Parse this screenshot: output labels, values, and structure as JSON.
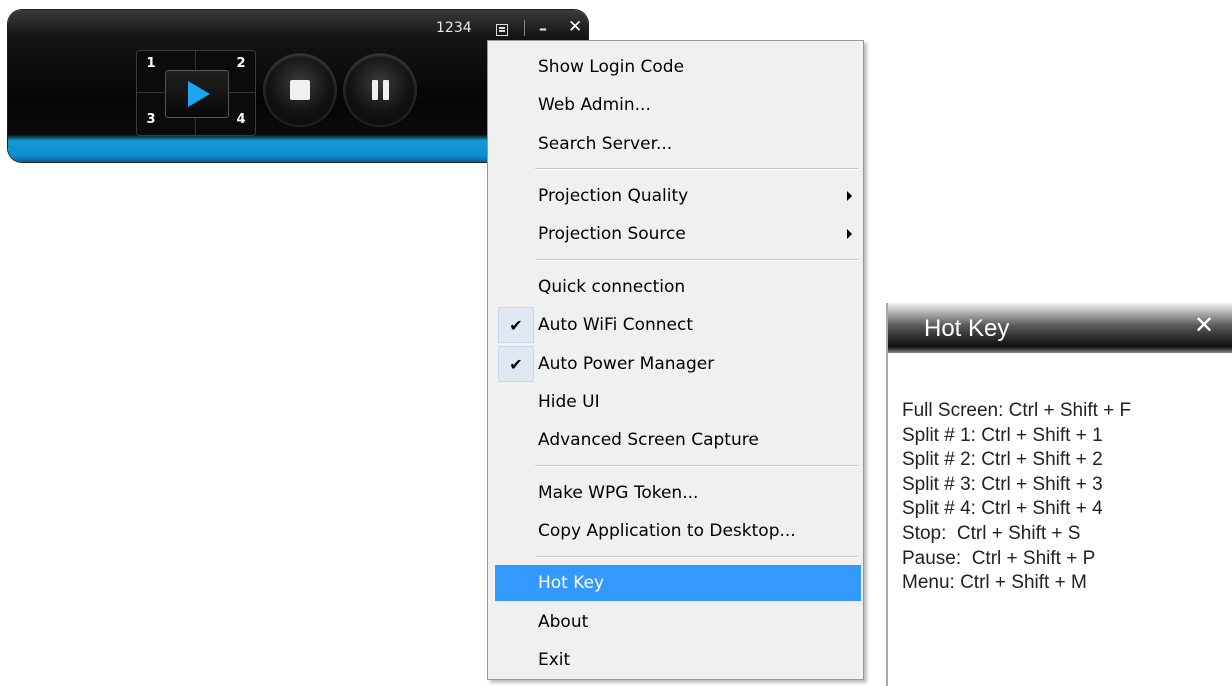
{
  "player": {
    "login_code": "1234",
    "split_labels": [
      "1",
      "2",
      "3",
      "4"
    ],
    "icons": {
      "play": "play-icon",
      "stop": "stop-icon",
      "pause": "pause-icon",
      "layout": "layout-icon",
      "minimize": "minimize-icon",
      "close": "close-icon"
    },
    "colors": {
      "accent": "#19a8ef",
      "bar_bottom": "#0a8fd0"
    }
  },
  "menu": {
    "items": [
      {
        "label": "Show Login Code",
        "checked": false,
        "submenu": false
      },
      {
        "label": "Web Admin...",
        "checked": false,
        "submenu": false
      },
      {
        "label": "Search Server...",
        "checked": false,
        "submenu": false
      },
      {
        "label": "Projection Quality",
        "checked": false,
        "submenu": true
      },
      {
        "label": "Projection Source",
        "checked": false,
        "submenu": true
      },
      {
        "label": "Quick connection",
        "checked": false,
        "submenu": false
      },
      {
        "label": "Auto WiFi Connect",
        "checked": true,
        "submenu": false
      },
      {
        "label": "Auto Power Manager",
        "checked": true,
        "submenu": false
      },
      {
        "label": "Hide UI",
        "checked": false,
        "submenu": false
      },
      {
        "label": "Advanced Screen Capture",
        "checked": false,
        "submenu": false
      },
      {
        "label": "Make WPG Token...",
        "checked": false,
        "submenu": false
      },
      {
        "label": "Copy Application to Desktop...",
        "checked": false,
        "submenu": false
      },
      {
        "label": "Hot Key",
        "checked": false,
        "submenu": false,
        "highlighted": true
      },
      {
        "label": "About",
        "checked": false,
        "submenu": false
      },
      {
        "label": "Exit",
        "checked": false,
        "submenu": false
      }
    ],
    "check_glyph": "✔",
    "highlight_color": "#3399ff"
  },
  "hotkey_window": {
    "title": "Hot Key",
    "close_glyph": "✕",
    "lines": [
      "Full Screen: Ctrl + Shift + F",
      "Split # 1: Ctrl + Shift + 1",
      "Split # 2: Ctrl + Shift + 2",
      "Split # 3: Ctrl + Shift + 3",
      "Split # 4: Ctrl + Shift + 4",
      "Stop:  Ctrl + Shift + S",
      "Pause:  Ctrl + Shift + P",
      "Menu: Ctrl + Shift + M"
    ]
  }
}
